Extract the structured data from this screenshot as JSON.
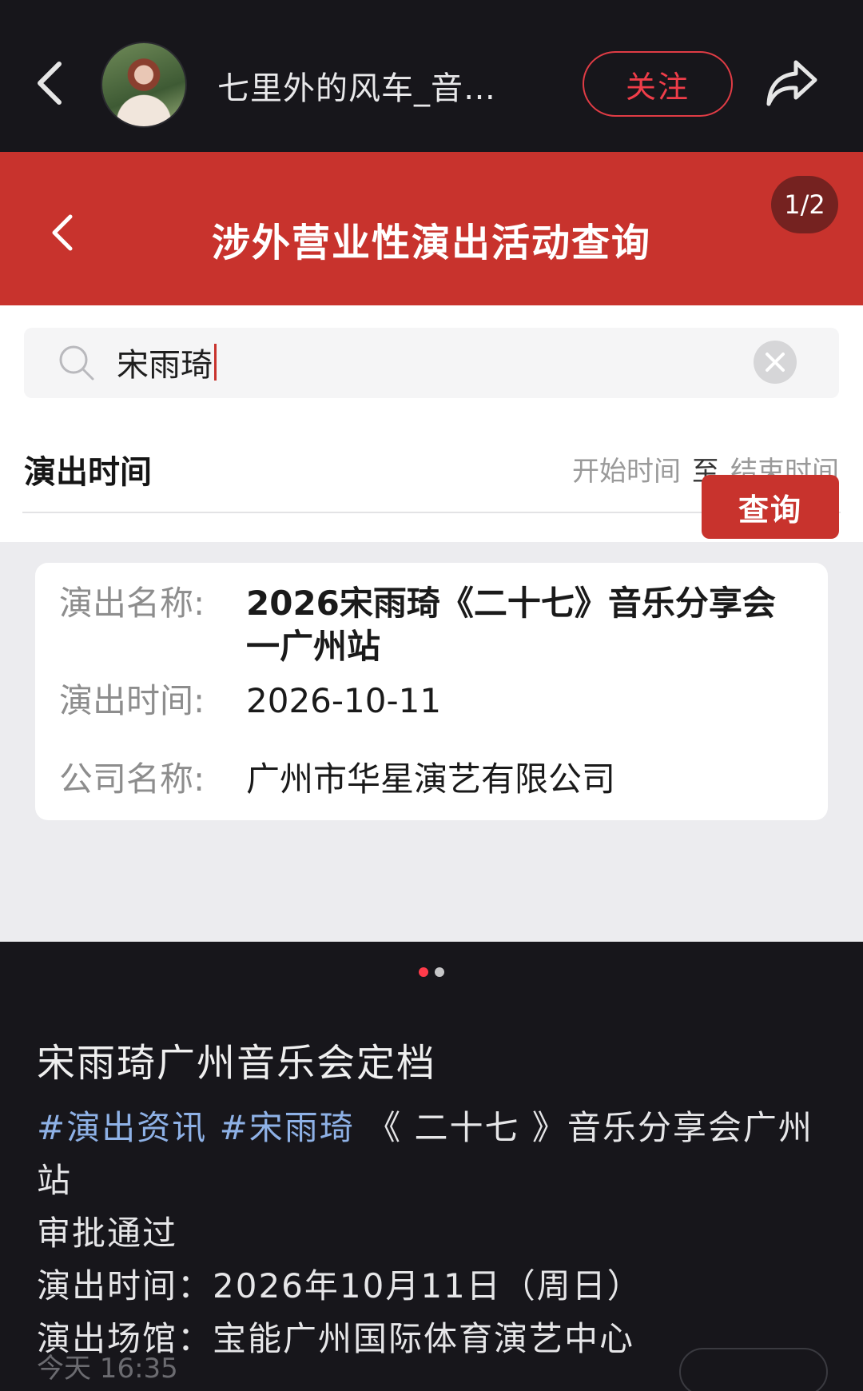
{
  "header": {
    "author_name": "七里外的风车_音…",
    "follow_label": "关注"
  },
  "card": {
    "title": "涉外营业性演出活动查询",
    "page_indicator": "1/2",
    "search": {
      "value": "宋雨琦"
    },
    "time_filter": {
      "label": "演出时间",
      "start_placeholder": "开始时间",
      "separator": "至",
      "end_placeholder": "结束时间"
    },
    "query_button": "查询",
    "result": {
      "name_label": "演出名称:",
      "name_value": "2026宋雨琦《二十七》音乐分享会一广州站",
      "time_label": "演出时间:",
      "time_value": "2026-10-11",
      "company_label": "公司名称:",
      "company_value": "广州市华星演艺有限公司"
    }
  },
  "carousel": {
    "current": 1,
    "total": 2
  },
  "post": {
    "title": "宋雨琦广州音乐会定档",
    "tag1": "#演出资讯",
    "tag2": "#宋雨琦",
    "line1_rest": " 《 二十七 》音乐分享会广州站",
    "line2": "审批通过",
    "line3": "演出时间：2026年10月11日（周日）",
    "line4": "演出场馆：宝能广州国际体育演艺中心",
    "timestamp": "今天 16:35"
  },
  "colors": {
    "accent_red": "#c8332d",
    "follow_red": "#ef3d49",
    "tag_blue": "#8eb1e6"
  },
  "icons": [
    "back-arrow-icon",
    "share-icon",
    "search-icon",
    "clear-icon"
  ]
}
